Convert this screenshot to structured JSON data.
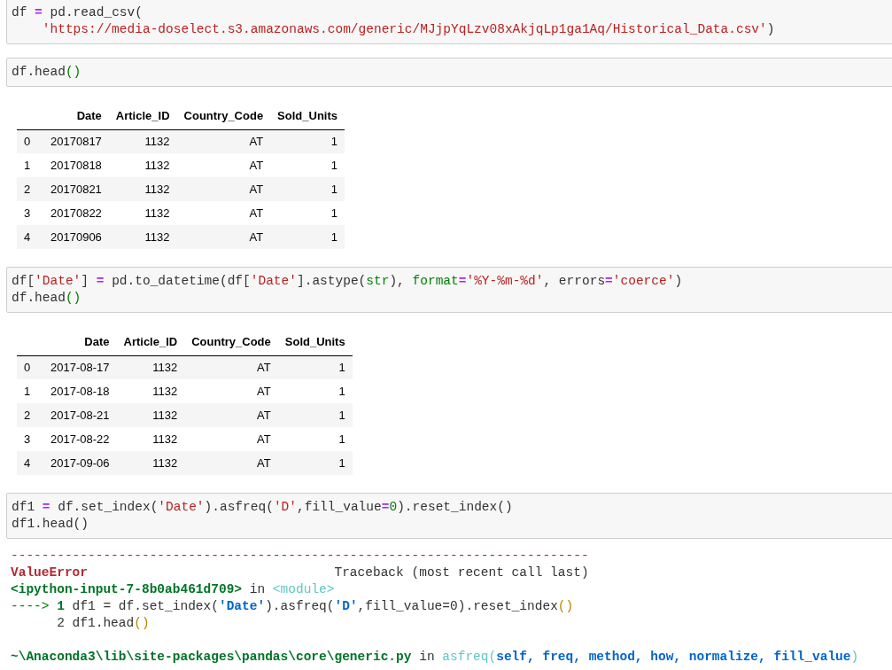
{
  "cells": [
    {
      "kind": "code",
      "lines": [
        [
          {
            "text": "df ",
            "kind": "plain"
          },
          {
            "text": "=",
            "kind": "op"
          },
          {
            "text": " pd.read_csv(",
            "kind": "plain"
          }
        ],
        [
          {
            "text": "    'https://media-doselect.s3.amazonaws.com/generic/MJjpYqLzv08xAkjqLp1ga1Aq/Historical_Data.csv'",
            "kind": "str"
          },
          {
            "text": ")",
            "kind": "plain"
          }
        ]
      ]
    },
    {
      "kind": "code",
      "lines": [
        [
          {
            "text": "df.head",
            "kind": "plain"
          },
          {
            "text": "()",
            "kind": "green"
          }
        ]
      ]
    },
    {
      "kind": "table",
      "columns": [
        "Date",
        "Article_ID",
        "Country_Code",
        "Sold_Units"
      ],
      "rows": [
        {
          "index": "0",
          "cells": [
            "20170817",
            "1132",
            "AT",
            "1"
          ]
        },
        {
          "index": "1",
          "cells": [
            "20170818",
            "1132",
            "AT",
            "1"
          ]
        },
        {
          "index": "2",
          "cells": [
            "20170821",
            "1132",
            "AT",
            "1"
          ]
        },
        {
          "index": "3",
          "cells": [
            "20170822",
            "1132",
            "AT",
            "1"
          ]
        },
        {
          "index": "4",
          "cells": [
            "20170906",
            "1132",
            "AT",
            "1"
          ]
        }
      ]
    },
    {
      "kind": "code",
      "lines": [
        [
          {
            "text": "df[",
            "kind": "plain"
          },
          {
            "text": "'Date'",
            "kind": "str"
          },
          {
            "text": "] ",
            "kind": "plain"
          },
          {
            "text": "=",
            "kind": "op"
          },
          {
            "text": " pd.to_datetime(df[",
            "kind": "plain"
          },
          {
            "text": "'Date'",
            "kind": "str"
          },
          {
            "text": "].astype(",
            "kind": "plain"
          },
          {
            "text": "str",
            "kind": "green"
          },
          {
            "text": "), ",
            "kind": "plain"
          },
          {
            "text": "format",
            "kind": "green"
          },
          {
            "text": "=",
            "kind": "op"
          },
          {
            "text": "'%Y-%m-%d'",
            "kind": "str"
          },
          {
            "text": ", errors",
            "kind": "plain"
          },
          {
            "text": "=",
            "kind": "op"
          },
          {
            "text": "'coerce'",
            "kind": "str"
          },
          {
            "text": ")",
            "kind": "plain"
          }
        ],
        [
          {
            "text": "df.head",
            "kind": "plain"
          },
          {
            "text": "()",
            "kind": "green"
          }
        ]
      ]
    },
    {
      "kind": "table",
      "columns": [
        "Date",
        "Article_ID",
        "Country_Code",
        "Sold_Units"
      ],
      "rows": [
        {
          "index": "0",
          "cells": [
            "2017-08-17",
            "1132",
            "AT",
            "1"
          ]
        },
        {
          "index": "1",
          "cells": [
            "2017-08-18",
            "1132",
            "AT",
            "1"
          ]
        },
        {
          "index": "2",
          "cells": [
            "2017-08-21",
            "1132",
            "AT",
            "1"
          ]
        },
        {
          "index": "3",
          "cells": [
            "2017-08-22",
            "1132",
            "AT",
            "1"
          ]
        },
        {
          "index": "4",
          "cells": [
            "2017-09-06",
            "1132",
            "AT",
            "1"
          ]
        }
      ]
    },
    {
      "kind": "code",
      "lines": [
        [
          {
            "text": "df1 ",
            "kind": "plain"
          },
          {
            "text": "=",
            "kind": "op"
          },
          {
            "text": " df.set_index(",
            "kind": "plain"
          },
          {
            "text": "'Date'",
            "kind": "str"
          },
          {
            "text": ").asfreq(",
            "kind": "plain"
          },
          {
            "text": "'D'",
            "kind": "str"
          },
          {
            "text": ",fill_value",
            "kind": "plain"
          },
          {
            "text": "=",
            "kind": "op"
          },
          {
            "text": "0",
            "kind": "green"
          },
          {
            "text": ").reset_index()",
            "kind": "plain"
          }
        ],
        [
          {
            "text": "df1.head()",
            "kind": "plain"
          }
        ]
      ]
    },
    {
      "kind": "error",
      "lines": [
        [
          {
            "text": "---------------------------------------------------------------------------",
            "kind": "red"
          }
        ],
        [
          {
            "text": "ValueError",
            "kind": "bold-red"
          },
          {
            "text": "                                Traceback (most recent call last)",
            "kind": "plain"
          }
        ],
        [
          {
            "text": "<ipython-input-7-8b0ab461d709>",
            "kind": "bold-green"
          },
          {
            "text": " in ",
            "kind": "plain"
          },
          {
            "text": "<module>",
            "kind": "cyan"
          }
        ],
        [
          {
            "text": "---->",
            "kind": "green"
          },
          {
            "text": " 1",
            "kind": "bold-green"
          },
          {
            "text": " df1 = df.set_index(",
            "kind": "plain"
          },
          {
            "text": "'Date'",
            "kind": "bold-blue"
          },
          {
            "text": ").asfreq(",
            "kind": "plain"
          },
          {
            "text": "'D'",
            "kind": "bold-blue"
          },
          {
            "text": ",fill_value=0).reset_index",
            "kind": "plain"
          },
          {
            "text": "()",
            "kind": "brown"
          }
        ],
        [
          {
            "text": "      2 df1.head",
            "kind": "plain"
          },
          {
            "text": "()",
            "kind": "brown"
          }
        ],
        [
          {
            "text": "~\\Anaconda3\\lib\\site-packages\\pandas\\core\\generic.py",
            "kind": "bold-green"
          },
          {
            "text": " in ",
            "kind": "plain"
          },
          {
            "text": "asfreq",
            "kind": "cyan"
          },
          {
            "text": "(",
            "kind": "cyan"
          },
          {
            "text": "self, freq, method, how, normalize, fill_value",
            "kind": "bold-blue"
          },
          {
            "text": ")",
            "kind": "cyan"
          }
        ]
      ]
    }
  ]
}
